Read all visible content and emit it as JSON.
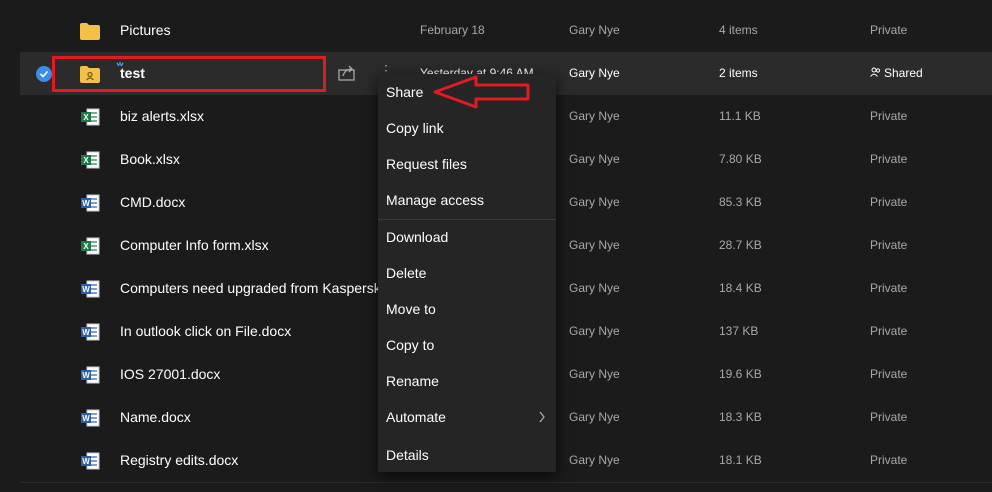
{
  "files": [
    {
      "name": "Pictures",
      "type": "folder",
      "modified": "February 18",
      "modified_by": "Gary Nye",
      "size": "4 items",
      "sharing": "Private"
    },
    {
      "name": "test",
      "type": "shared-folder",
      "modified": "Yesterday at 9:46 AM",
      "modified_by": "Gary Nye",
      "size": "2 items",
      "sharing": "Shared",
      "selected": true
    },
    {
      "name": "biz alerts.xlsx",
      "type": "excel",
      "modified": "",
      "modified_by": "Gary Nye",
      "size": "11.1 KB",
      "sharing": "Private"
    },
    {
      "name": "Book.xlsx",
      "type": "excel",
      "modified": "",
      "modified_by": "Gary Nye",
      "size": "7.80 KB",
      "sharing": "Private"
    },
    {
      "name": "CMD.docx",
      "type": "word",
      "modified": "",
      "modified_by": "Gary Nye",
      "size": "85.3 KB",
      "sharing": "Private"
    },
    {
      "name": "Computer Info form.xlsx",
      "type": "excel",
      "modified": "",
      "modified_by": "Gary Nye",
      "size": "28.7 KB",
      "sharing": "Private"
    },
    {
      "name": "Computers need upgraded from Kaspersk",
      "type": "word",
      "modified": "",
      "modified_by": "Gary Nye",
      "size": "18.4 KB",
      "sharing": "Private"
    },
    {
      "name": "In outlook click on File.docx",
      "type": "word",
      "modified": "",
      "modified_by": "Gary Nye",
      "size": "137 KB",
      "sharing": "Private"
    },
    {
      "name": "IOS 27001.docx",
      "type": "word",
      "modified": "",
      "modified_by": "Gary Nye",
      "size": "19.6 KB",
      "sharing": "Private"
    },
    {
      "name": "Name.docx",
      "type": "word",
      "modified": "",
      "modified_by": "Gary Nye",
      "size": "18.3 KB",
      "sharing": "Private"
    },
    {
      "name": "Registry edits.docx",
      "type": "word",
      "modified": "",
      "modified_by": "Gary Nye",
      "size": "18.1 KB",
      "sharing": "Private"
    }
  ],
  "context_menu": {
    "items": [
      "Share",
      "Copy link",
      "Request files",
      "Manage access",
      "Download",
      "Delete",
      "Move to",
      "Copy to",
      "Rename",
      "Automate",
      "Details"
    ],
    "submenu_item": "Automate"
  },
  "icons": {
    "folder": "folder-icon",
    "shared_folder": "shared-folder-icon",
    "excel": "excel-file-icon",
    "word": "word-file-icon",
    "row_share": "share-icon",
    "more": "more-vertical-icon",
    "shared_people": "people-icon",
    "selected_check": "checkmark-icon",
    "submenu": "chevron-right-icon"
  },
  "colors": {
    "background": "#1b1b1b",
    "selected_row": "#2b2b2b",
    "menu": "#252525",
    "folder": "#f3c04a",
    "excel": "#1d7a45",
    "word": "#2b5faa",
    "accent": "#3a8ee6",
    "highlight": "#e01b24"
  }
}
